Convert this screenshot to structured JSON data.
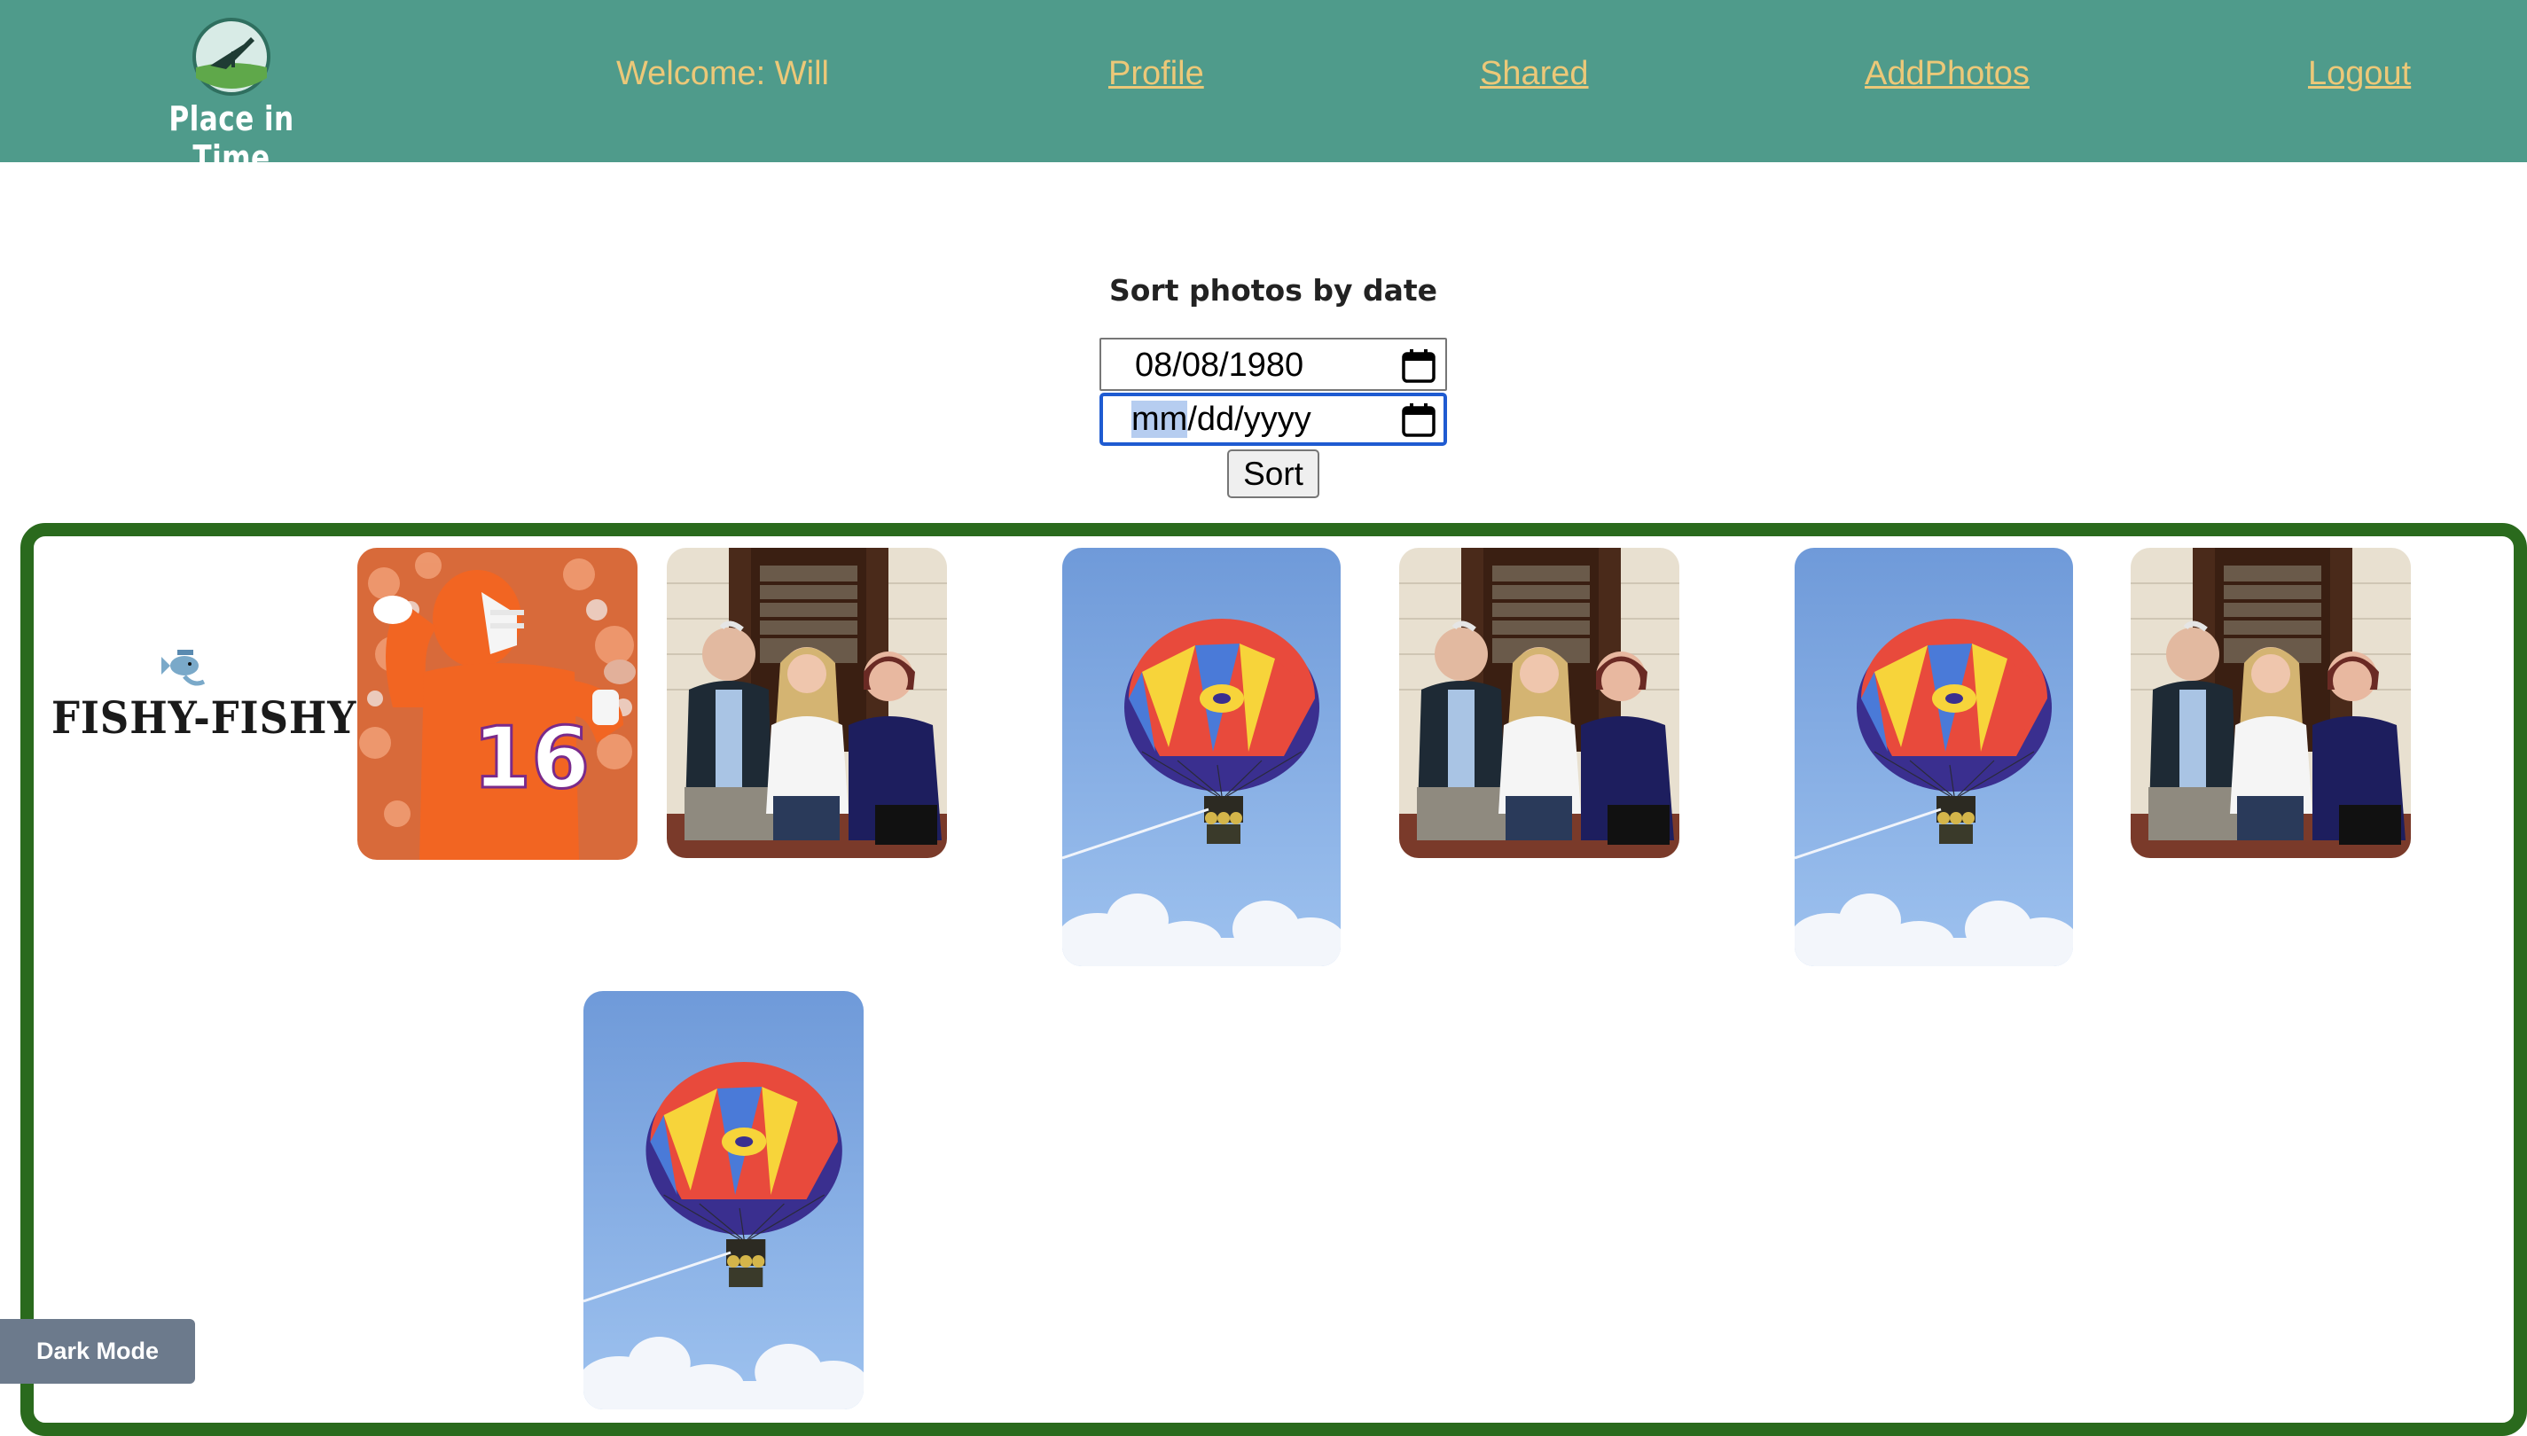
{
  "header": {
    "brand_name": "Place in Time",
    "welcome": "Welcome: Will",
    "nav": {
      "profile": "Profile",
      "shared": "Shared",
      "add_photos": "AddPhotos",
      "logout": "Logout"
    }
  },
  "sort_form": {
    "title": "Sort photos by date",
    "start_date": "08/08/1980",
    "end_date_placeholder": {
      "month": "mm",
      "rest": "/dd/yyyy"
    },
    "sort_button": "Sort"
  },
  "gallery": {
    "logo_text": "FISHY-FISHY",
    "photos": [
      {
        "subject": "football-player",
        "jersey_number": "16"
      },
      {
        "subject": "family-group"
      },
      {
        "subject": "parasail"
      },
      {
        "subject": "family-group"
      },
      {
        "subject": "parasail"
      },
      {
        "subject": "family-group"
      },
      {
        "subject": "parasail"
      }
    ]
  },
  "dark_mode_button": "Dark Mode",
  "colors": {
    "navbar": "#4f9b8b",
    "nav_text": "#ecc878",
    "gallery_border": "#2a6a1d",
    "focus_ring": "#1f5bd1",
    "dark_mode_bg": "#6c7a8c"
  }
}
